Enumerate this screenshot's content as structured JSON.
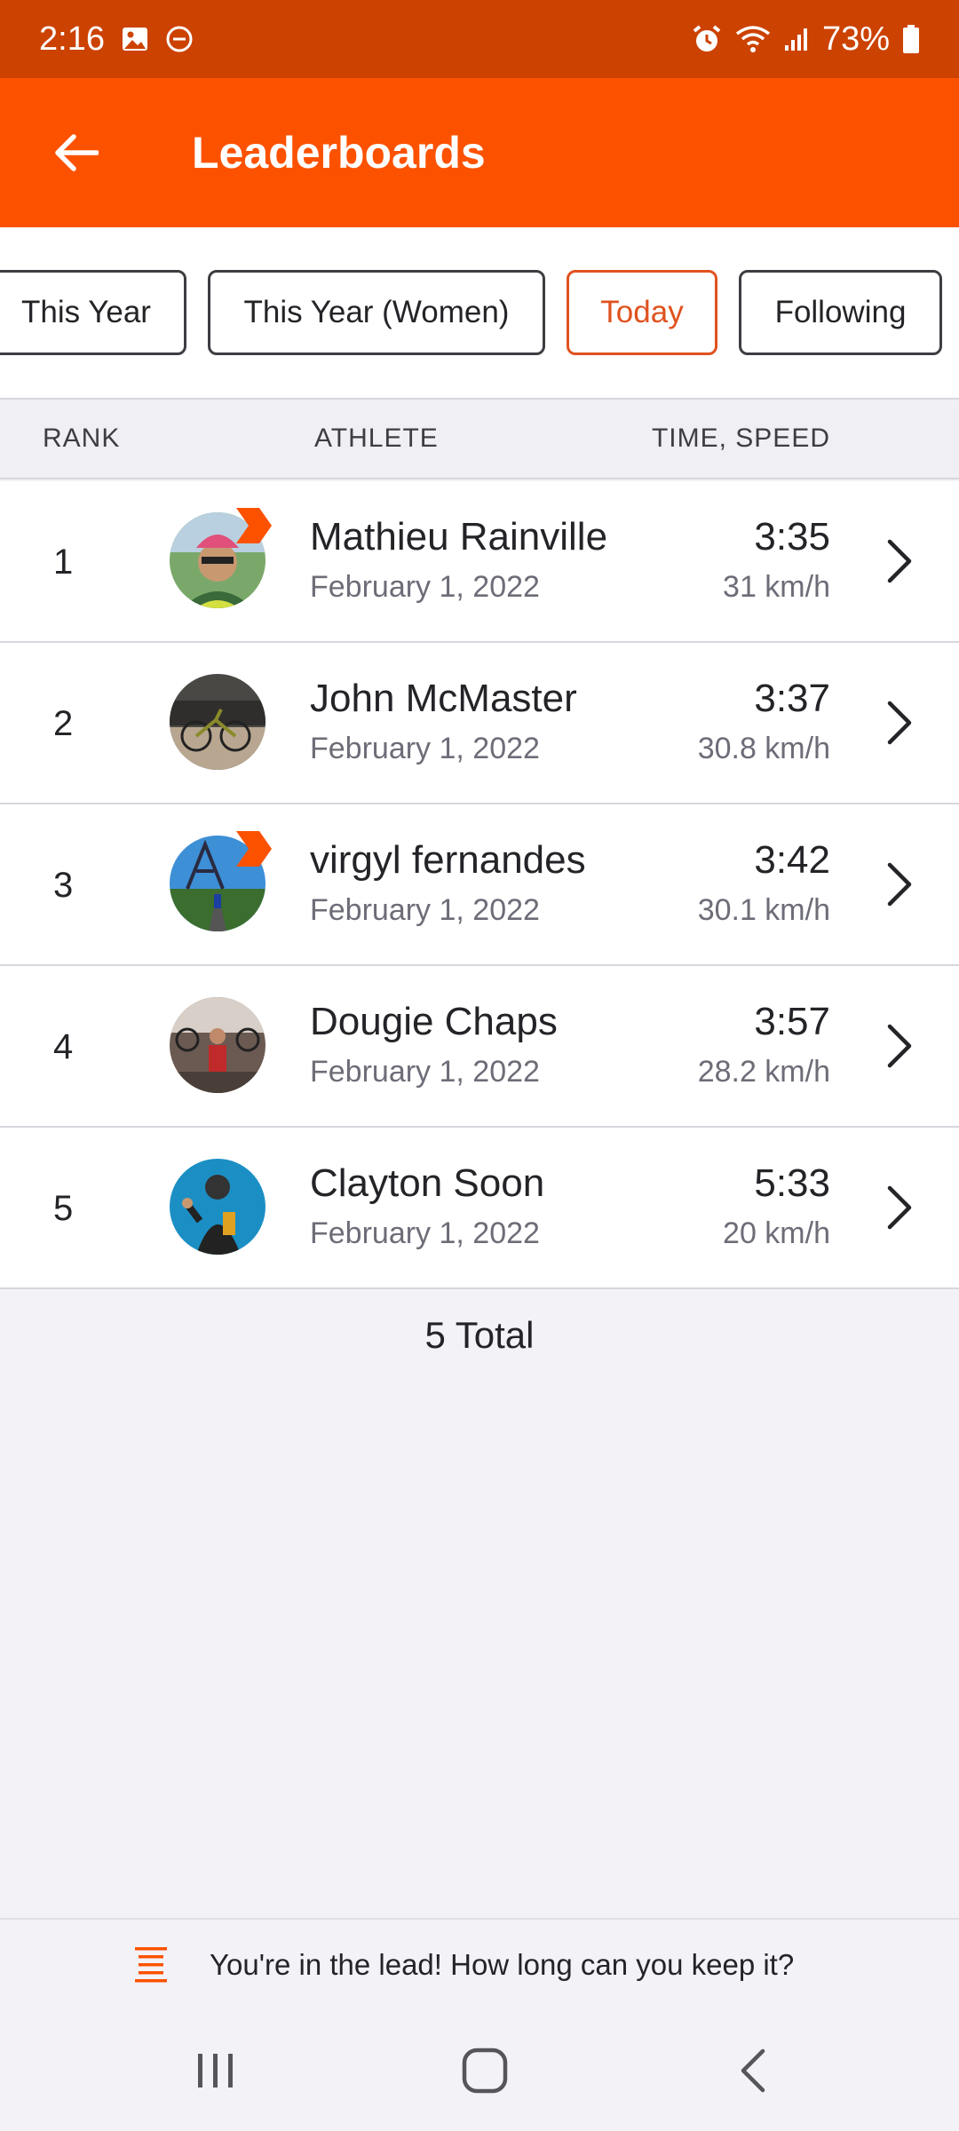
{
  "status_bar": {
    "time": "2:16",
    "battery": "73%"
  },
  "app_bar": {
    "title": "Leaderboards",
    "back_icon": "arrow-left-icon"
  },
  "filters": [
    {
      "label": "This Year",
      "active": false
    },
    {
      "label": "This Year (Women)",
      "active": false
    },
    {
      "label": "Today",
      "active": true
    },
    {
      "label": "Following",
      "active": false
    }
  ],
  "table": {
    "headers": {
      "rank": "RANK",
      "athlete": "ATHLETE",
      "time_speed": "TIME, SPEED"
    },
    "rows": [
      {
        "rank": "1",
        "name": "Mathieu Rainville",
        "date": "February 1, 2022",
        "time": "3:35",
        "speed": "31 km/h",
        "badge": true
      },
      {
        "rank": "2",
        "name": "John McMaster",
        "date": "February 1, 2022",
        "time": "3:37",
        "speed": "30.8 km/h",
        "badge": false
      },
      {
        "rank": "3",
        "name": "virgyl fernandes",
        "date": "February 1, 2022",
        "time": "3:42",
        "speed": "30.1 km/h",
        "badge": true
      },
      {
        "rank": "4",
        "name": "Dougie Chaps",
        "date": "February 1, 2022",
        "time": "3:57",
        "speed": "28.2 km/h",
        "badge": false
      },
      {
        "rank": "5",
        "name": "Clayton Soon",
        "date": "February 1, 2022",
        "time": "5:33",
        "speed": "20 km/h",
        "badge": false
      }
    ]
  },
  "total": "5 Total",
  "banner": {
    "text": "You're in the lead!  How long can you keep it?"
  },
  "colors": {
    "brand": "#fc5200",
    "status_bar": "#cc4200",
    "active_chip": "#e0521f"
  }
}
